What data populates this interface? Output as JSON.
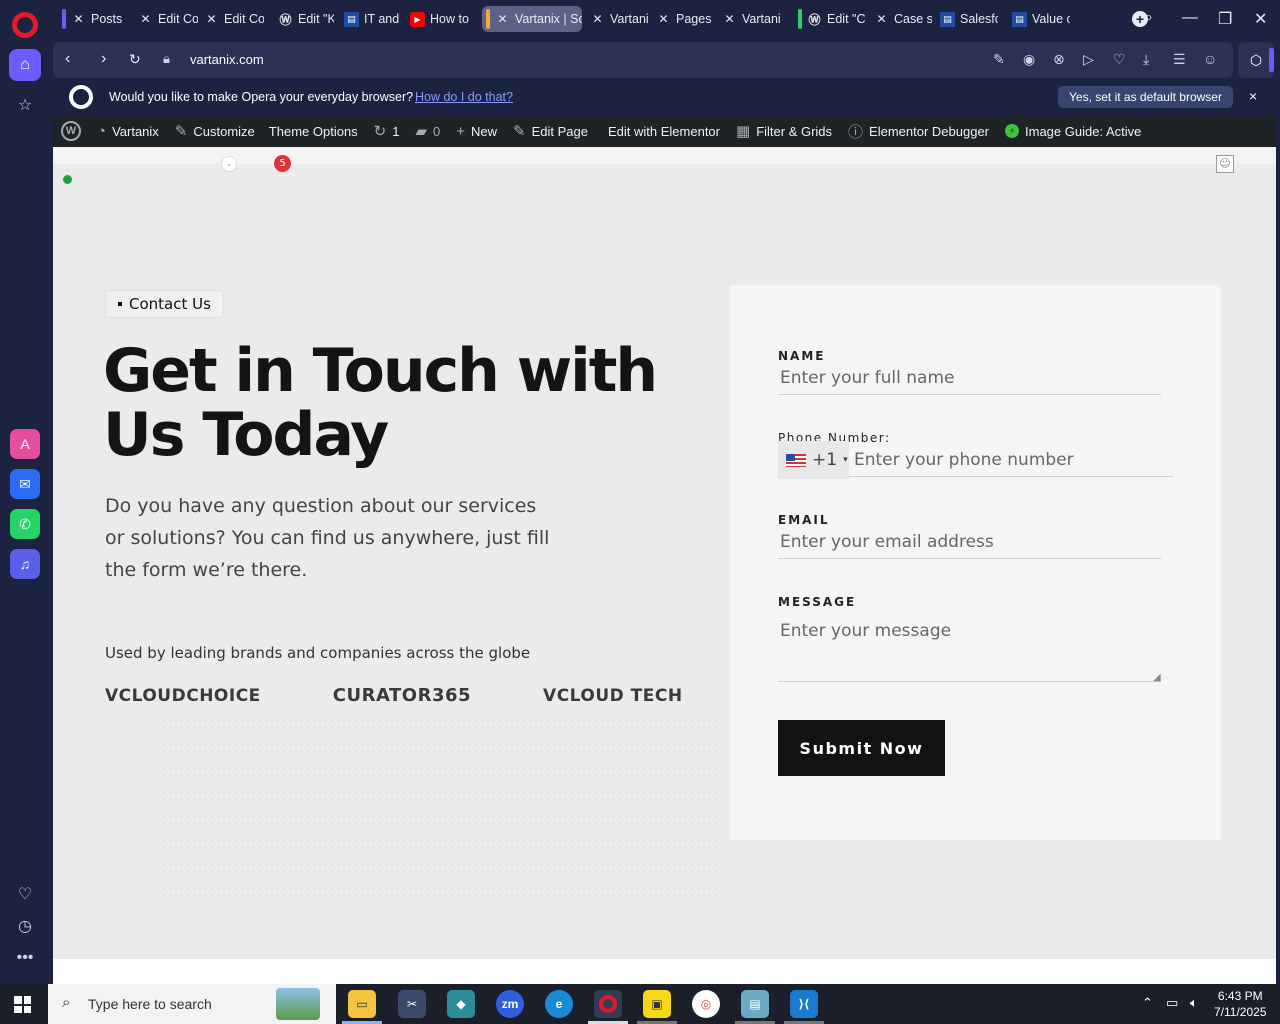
{
  "browser": {
    "tabs": [
      {
        "label": "Posts",
        "icon": "vartanix-x-icon"
      },
      {
        "label": "Edit Co",
        "icon": "vartanix-x-icon"
      },
      {
        "label": "Edit Co",
        "icon": "vartanix-x-icon"
      },
      {
        "label": "Edit \"K",
        "icon": "wordpress-icon"
      },
      {
        "label": "IT and",
        "icon": "page-icon"
      },
      {
        "label": "How to",
        "icon": "youtube-icon"
      },
      {
        "label": "Vartanix | So",
        "icon": "vartanix-x-icon",
        "active": true
      },
      {
        "label": "Vartani",
        "icon": "vartanix-x-icon"
      },
      {
        "label": "Pages",
        "icon": "vartanix-x-icon"
      },
      {
        "label": "Vartani",
        "icon": "vartanix-x-icon"
      },
      {
        "label": "Edit \"C",
        "icon": "wordpress-icon"
      },
      {
        "label": "Case st",
        "icon": "vartanix-x-icon"
      },
      {
        "label": "Salesfo",
        "icon": "page-icon"
      },
      {
        "label": "Value c",
        "icon": "page-icon"
      }
    ],
    "url": "vartanix.com"
  },
  "banner": {
    "question": "Would you like to make Opera your everyday browser?",
    "link": "How do I do that?",
    "cta": "Yes, set it as default browser",
    "close": "×"
  },
  "wp_bar": {
    "site": "Vartanix",
    "customize": "Customize",
    "theme_options": "Theme Options",
    "updates_count": "1",
    "comments_count": "0",
    "new": "New",
    "edit_page": "Edit Page",
    "edit_elementor": "Edit with Elementor",
    "filter_grids": "Filter & Grids",
    "debugger": "Elementor Debugger",
    "image_guide": "Image Guide: Active"
  },
  "page": {
    "notification_count": "5",
    "pill": "Contact Us",
    "heading": "Get in Touch with Us Today",
    "subtext": "Do you have any question about our services or solutions? You can find us anywhere, just fill the form we’re there.",
    "used_by": "Used by leading brands and companies across the globe",
    "logos": [
      "VCLOUDCHOICE",
      "CURATOR365",
      "VCLOUD TECH"
    ]
  },
  "form": {
    "name_label": "NAME",
    "name_placeholder": "Enter your full name",
    "phone_label": "Phone Number:",
    "phone_code": "+1",
    "phone_placeholder": "Enter your phone number",
    "email_label": "EMAIL",
    "email_placeholder": "Enter your email address",
    "message_label": "MESSAGE",
    "message_placeholder": "Enter your message",
    "submit": "Submit Now"
  },
  "taskbar": {
    "search_placeholder": "Type here to search",
    "time": "6:43 PM",
    "date": "7/11/2025"
  },
  "colors": {
    "accent": "#6b5cff",
    "opera_red": "#e21b2c",
    "wp_bar": "#1d2327",
    "button": "#121212"
  }
}
